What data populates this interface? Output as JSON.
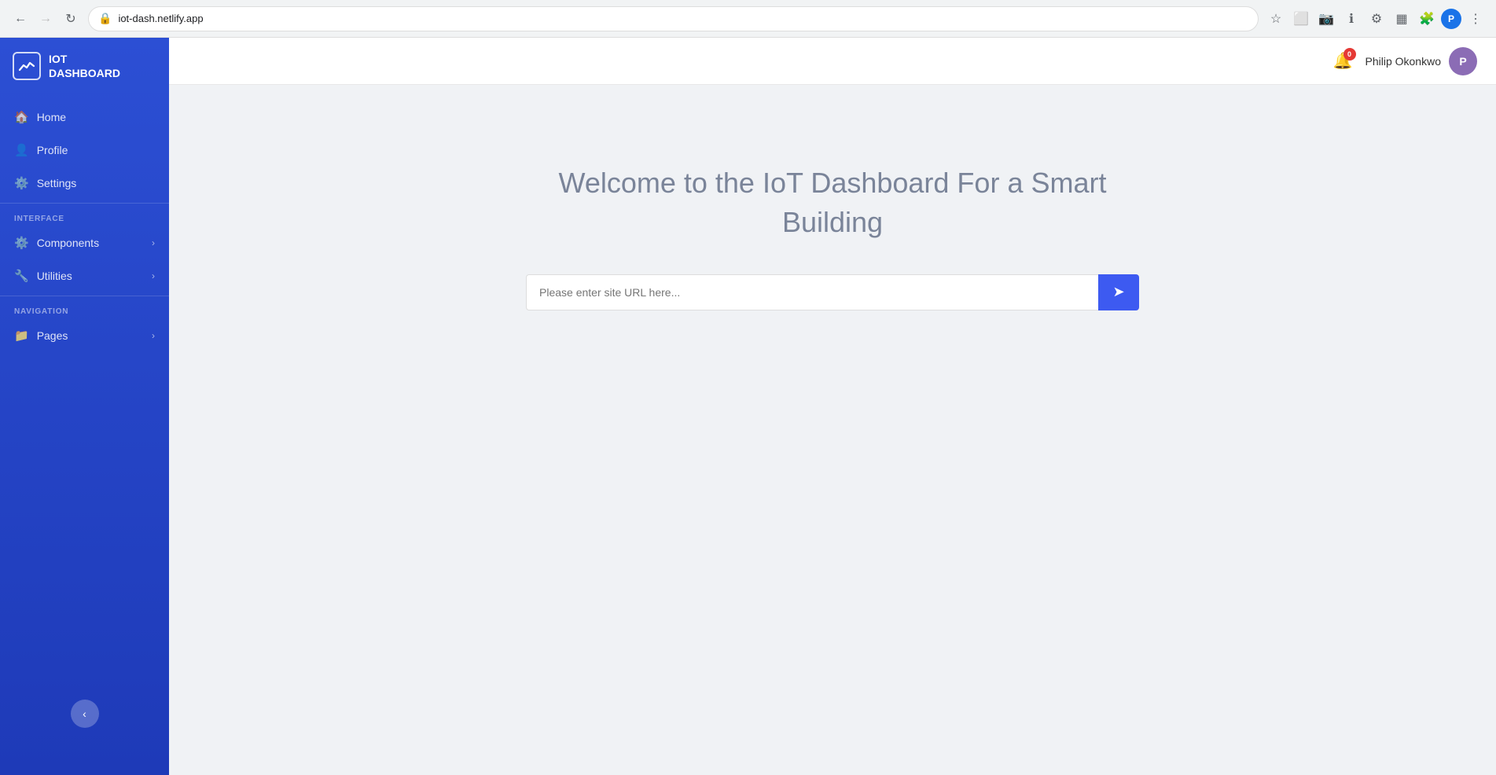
{
  "browser": {
    "url": "iot-dash.netlify.app",
    "back_disabled": false,
    "forward_disabled": true
  },
  "header": {
    "notification_count": "0",
    "user_name": "Philip Okonkwo"
  },
  "sidebar": {
    "logo_title": "IOT",
    "logo_subtitle": "DASHBOARD",
    "nav_items": [
      {
        "id": "home",
        "label": "Home",
        "icon": "🏠",
        "has_chevron": false
      },
      {
        "id": "profile",
        "label": "Profile",
        "icon": "👤",
        "has_chevron": false
      },
      {
        "id": "settings",
        "label": "Settings",
        "icon": "⚙️",
        "has_chevron": false
      }
    ],
    "interface_section_label": "INTERFACE",
    "interface_items": [
      {
        "id": "components",
        "label": "Components",
        "icon": "⚙️",
        "has_chevron": true
      },
      {
        "id": "utilities",
        "label": "Utilities",
        "icon": "🔧",
        "has_chevron": true
      }
    ],
    "navigation_section_label": "NAVIGATION",
    "navigation_items": [
      {
        "id": "pages",
        "label": "Pages",
        "icon": "📁",
        "has_chevron": true
      }
    ],
    "collapse_button_label": "‹"
  },
  "main": {
    "welcome_title": "Welcome to the IoT Dashboard For a Smart Building",
    "url_input_placeholder": "Please enter site URL here...",
    "url_submit_icon": "➜"
  }
}
